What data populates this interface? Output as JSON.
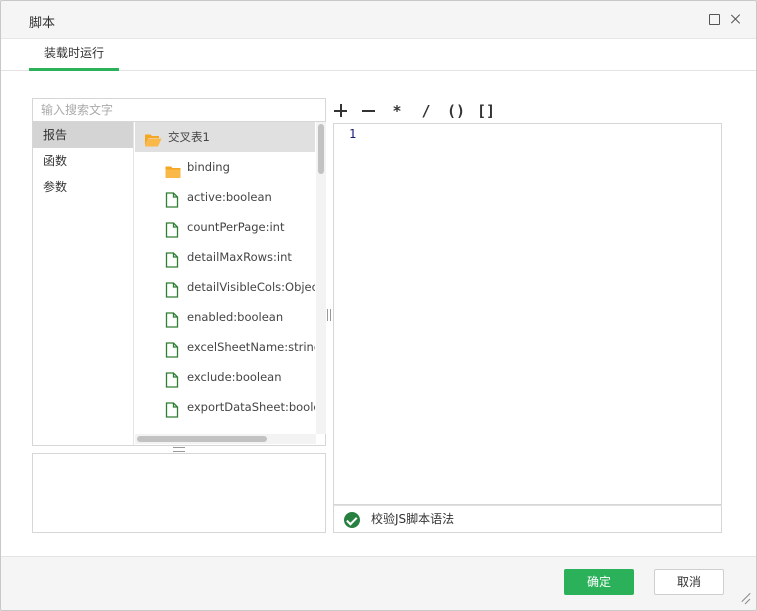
{
  "dialog": {
    "title": "脚本"
  },
  "tabs": [
    {
      "label": "装载时运行"
    }
  ],
  "search": {
    "placeholder": "输入搜索文字"
  },
  "categories": [
    {
      "label": "报告"
    },
    {
      "label": "函数"
    },
    {
      "label": "参数"
    }
  ],
  "tree": {
    "root": {
      "label": "交叉表1",
      "icon": "folder-open-icon"
    },
    "children": [
      {
        "label": "binding",
        "icon": "folder-icon"
      },
      {
        "label": "active:boolean",
        "icon": "file-icon"
      },
      {
        "label": "countPerPage:int",
        "icon": "file-icon"
      },
      {
        "label": "detailMaxRows:int",
        "icon": "file-icon"
      },
      {
        "label": "detailVisibleCols:Object",
        "icon": "file-icon"
      },
      {
        "label": "enabled:boolean",
        "icon": "file-icon"
      },
      {
        "label": "excelSheetName:string",
        "icon": "file-icon"
      },
      {
        "label": "exclude:boolean",
        "icon": "file-icon"
      },
      {
        "label": "exportDataSheet:boolean",
        "icon": "file-icon"
      }
    ]
  },
  "operators": [
    "+",
    "−",
    "*",
    "/",
    "()",
    "[]"
  ],
  "editor": {
    "line_numbers": [
      "1"
    ]
  },
  "verify": {
    "label": "校验JS脚本语法"
  },
  "footer": {
    "ok_label": "确定",
    "cancel_label": "取消"
  },
  "colors": {
    "accent": "#2bb15a",
    "file_icon": "#2e7d32",
    "folder_icon": "#f5a623"
  }
}
